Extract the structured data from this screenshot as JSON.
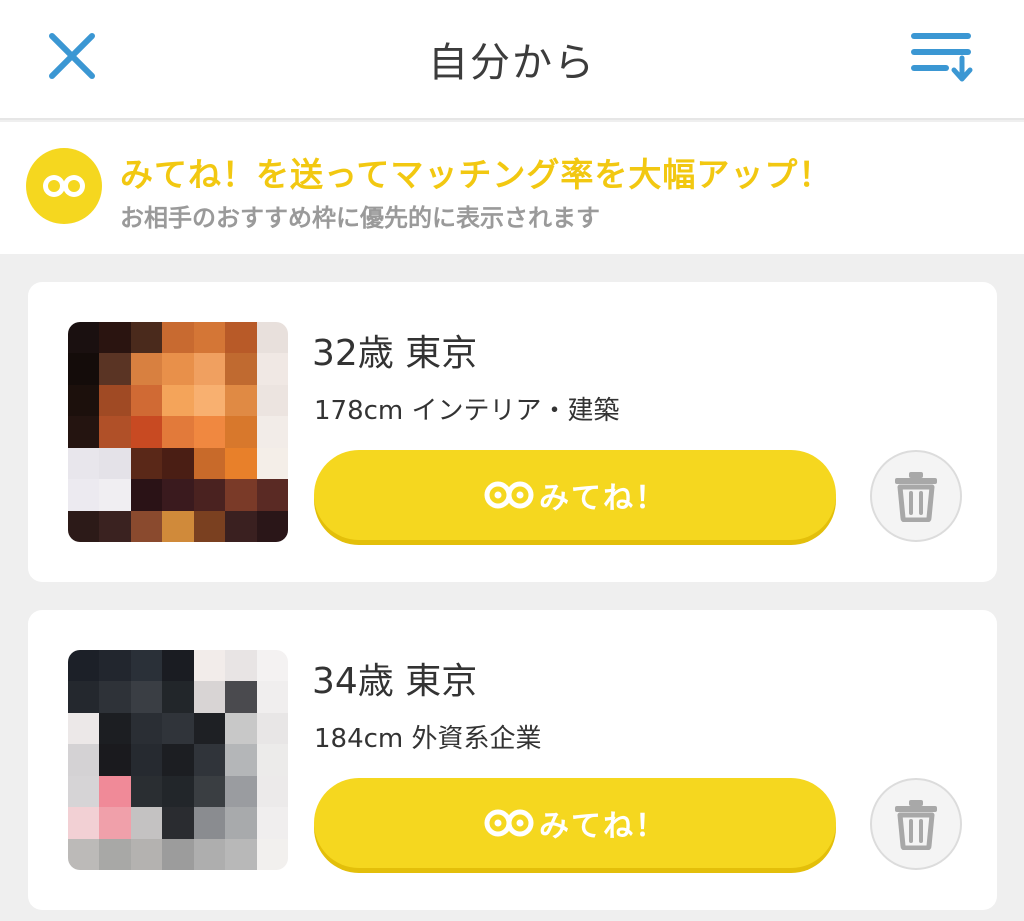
{
  "header": {
    "title": "自分から",
    "close_icon": "close-icon",
    "sort_icon": "sort-icon",
    "accent_color": "#3b97d3"
  },
  "promo": {
    "icon": "eyes-icon",
    "title": "みてね！を送ってマッチング率を大幅アップ！",
    "subtitle": "お相手のおすすめ枠に優先的に表示されます",
    "accent_color": "#f5d71f"
  },
  "cards": [
    {
      "age_location": "32歳 東京",
      "details": "178cm インテリア・建築",
      "button_label": "みてね！",
      "button_icon": "eyes-icon",
      "delete_icon": "trash-icon",
      "photo_pixels": [
        "#1a1010",
        "#2a1410",
        "#4a2a1c",
        "#c86a30",
        "#d47636",
        "#b85a28",
        "#e8e0dc",
        "#140c0a",
        "#5a3424",
        "#d88040",
        "#e8904a",
        "#f0a060",
        "#c06a30",
        "#f0e8e4",
        "#1c100c",
        "#a04a24",
        "#d06a34",
        "#f4a45a",
        "#f8b070",
        "#e08a44",
        "#ece4e0",
        "#241410",
        "#b05028",
        "#c84a22",
        "#e27a3a",
        "#f08840",
        "#d8782c",
        "#f2ece8",
        "#e8e6ec",
        "#e4e2e8",
        "#5a2818",
        "#4a1e14",
        "#c86a2a",
        "#e8802a",
        "#f4eee8",
        "#eceaf0",
        "#f0eef2",
        "#2a1216",
        "#3a1a1e",
        "#4a2220",
        "#7a3a28",
        "#5a2a24",
        "#2c1a18",
        "#3a2220",
        "#8a4a2e",
        "#d08a3a",
        "#7a4020",
        "#3a2020",
        "#2a1618"
      ]
    },
    {
      "age_location": "34歳 東京",
      "details": "184cm 外資系企業",
      "button_label": "みてね！",
      "button_icon": "eyes-icon",
      "delete_icon": "trash-icon",
      "photo_pixels": [
        "#1c2028",
        "#22262e",
        "#2a3038",
        "#1a1c22",
        "#f2ecea",
        "#e8e4e4",
        "#f4f2f2",
        "#24282e",
        "#2e3238",
        "#3a3e44",
        "#22262a",
        "#d8d4d4",
        "#4a4a4e",
        "#f0eeee",
        "#ece8e8",
        "#1c1e22",
        "#2a2e34",
        "#30343a",
        "#1e2024",
        "#c8c8c8",
        "#e8e6e6",
        "#d4d2d4",
        "#1a1a1e",
        "#262a30",
        "#1c1e22",
        "#30343a",
        "#b4b6b8",
        "#ecebea",
        "#d6d4d6",
        "#f08a98",
        "#2a2e32",
        "#22262a",
        "#3a3e42",
        "#9a9ca0",
        "#eceaea",
        "#f2d0d4",
        "#f0a0aa",
        "#c4c2c2",
        "#2a2c30",
        "#8a8c90",
        "#a8aaac",
        "#f0eeee",
        "#bcbab8",
        "#a8a8a6",
        "#b4b2b0",
        "#9c9c9c",
        "#aeaeae",
        "#b8b8b8",
        "#f2f0ee"
      ]
    }
  ]
}
